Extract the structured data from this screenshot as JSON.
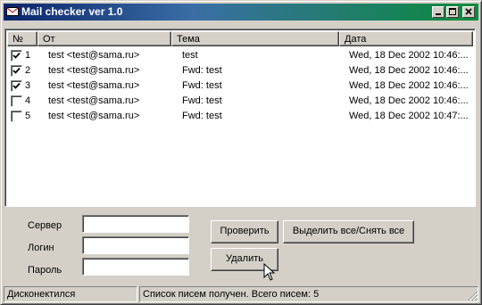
{
  "window": {
    "title": "Mail checker ver 1.0"
  },
  "list": {
    "columns": [
      "№",
      "От",
      "Тема",
      "Дата"
    ],
    "rows": [
      {
        "checked": true,
        "num": "1",
        "from": "test <test@sama.ru>",
        "subject": "test",
        "date": "Wed, 18 Dec 2002 10:46:..."
      },
      {
        "checked": true,
        "num": "2",
        "from": "test <test@sama.ru>",
        "subject": "Fwd: test",
        "date": "Wed, 18 Dec 2002 10:46:..."
      },
      {
        "checked": true,
        "num": "3",
        "from": "test <test@sama.ru>",
        "subject": "Fwd: test",
        "date": "Wed, 18 Dec 2002 10:46:..."
      },
      {
        "checked": false,
        "num": "4",
        "from": "test <test@sama.ru>",
        "subject": "Fwd: test",
        "date": "Wed, 18 Dec 2002 10:46:..."
      },
      {
        "checked": false,
        "num": "5",
        "from": "test <test@sama.ru>",
        "subject": "Fwd: test",
        "date": "Wed, 18 Dec 2002 10:47:..."
      }
    ]
  },
  "form": {
    "server_label": "Сервер",
    "login_label": "Логин",
    "password_label": "Пароль",
    "server_value": "",
    "login_value": "",
    "password_value": ""
  },
  "buttons": {
    "check": "Проверить",
    "select_all": "Выделить все/Снять все",
    "delete": "Удалить"
  },
  "status": {
    "connection": "Дисконектился",
    "message": "Список писем получен. Всего писем: 5"
  },
  "colors": {
    "title_start": "#0a246a",
    "title_end": "#0a8a3a",
    "face": "#d4d0c8"
  }
}
